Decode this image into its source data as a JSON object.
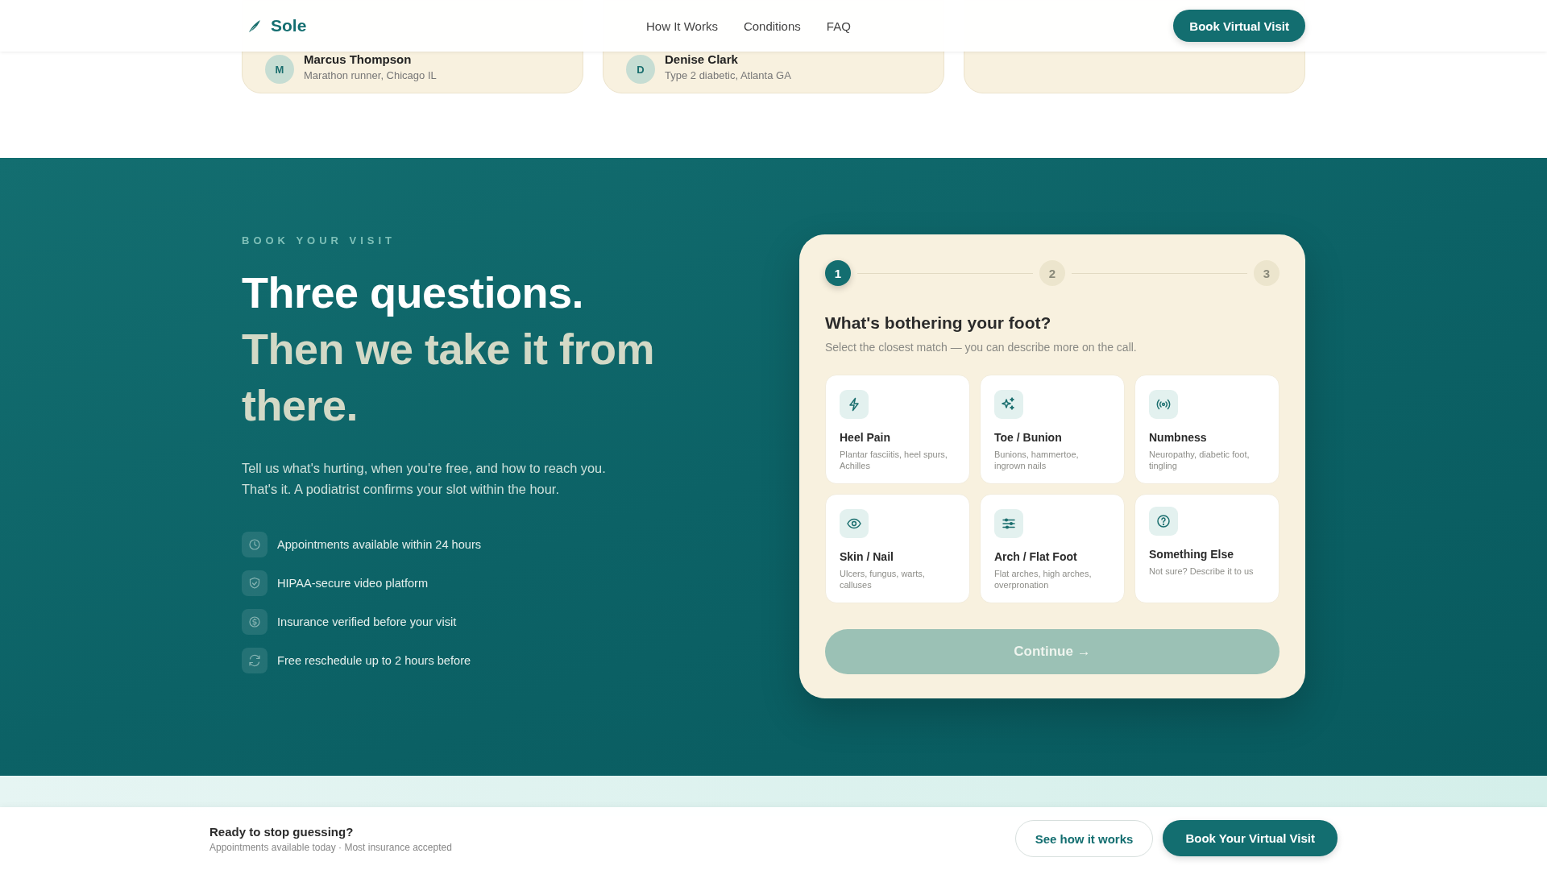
{
  "nav": {
    "brand": "Sole",
    "links": [
      "How It Works",
      "Conditions",
      "FAQ"
    ],
    "cta": "Book Virtual Visit"
  },
  "testimonials": [
    {
      "initial": "M",
      "name": "Marcus Thompson",
      "detail": "Marathon runner, Chicago IL"
    },
    {
      "initial": "D",
      "name": "Denise Clark",
      "detail": "Type 2 diabetic, Atlanta GA"
    }
  ],
  "booking": {
    "eyebrow": "BOOK YOUR VISIT",
    "headline": "Three questions.",
    "headline_accent": "Then we take it from there.",
    "intro": [
      "Tell us what's hurting, when you're free, and how to reach you.",
      "That's it. A podiatrist confirms your slot within the hour."
    ],
    "features": [
      "Appointments available within 24 hours",
      "HIPAA-secure video platform",
      "Insurance verified before your visit",
      "Free reschedule up to 2 hours before"
    ],
    "form": {
      "steps": [
        {
          "label": "1",
          "selected": true
        },
        {
          "label": "2",
          "selected": false
        },
        {
          "label": "3",
          "selected": false
        }
      ],
      "question": "What's bothering your foot?",
      "hint": "Select the closest match — you can describe more on the call.",
      "options": [
        {
          "title": "Heel Pain",
          "detail": "Plantar fasciitis, heel spurs, Achilles",
          "selected": false
        },
        {
          "title": "Toe / Bunion",
          "detail": "Bunions, hammertoe, ingrown nails",
          "selected": false
        },
        {
          "title": "Numbness",
          "detail": "Neuropathy, diabetic foot, tingling",
          "selected": false
        },
        {
          "title": "Skin / Nail",
          "detail": "Ulcers, fungus, warts, calluses",
          "selected": false
        },
        {
          "title": "Arch / Flat Foot",
          "detail": "Flat arches, high arches, overpronation",
          "selected": false
        },
        {
          "title": "Something Else",
          "detail": "Not sure? Describe it to us",
          "selected": false
        }
      ],
      "continue": {
        "label": "Continue →",
        "disabled": true
      }
    }
  },
  "sticky_bar": {
    "title": "Ready to stop guessing?",
    "subtitle": "Appointments available today · Most insurance accepted",
    "secondary": "See how it works",
    "primary": "Book Your Virtual Visit"
  }
}
